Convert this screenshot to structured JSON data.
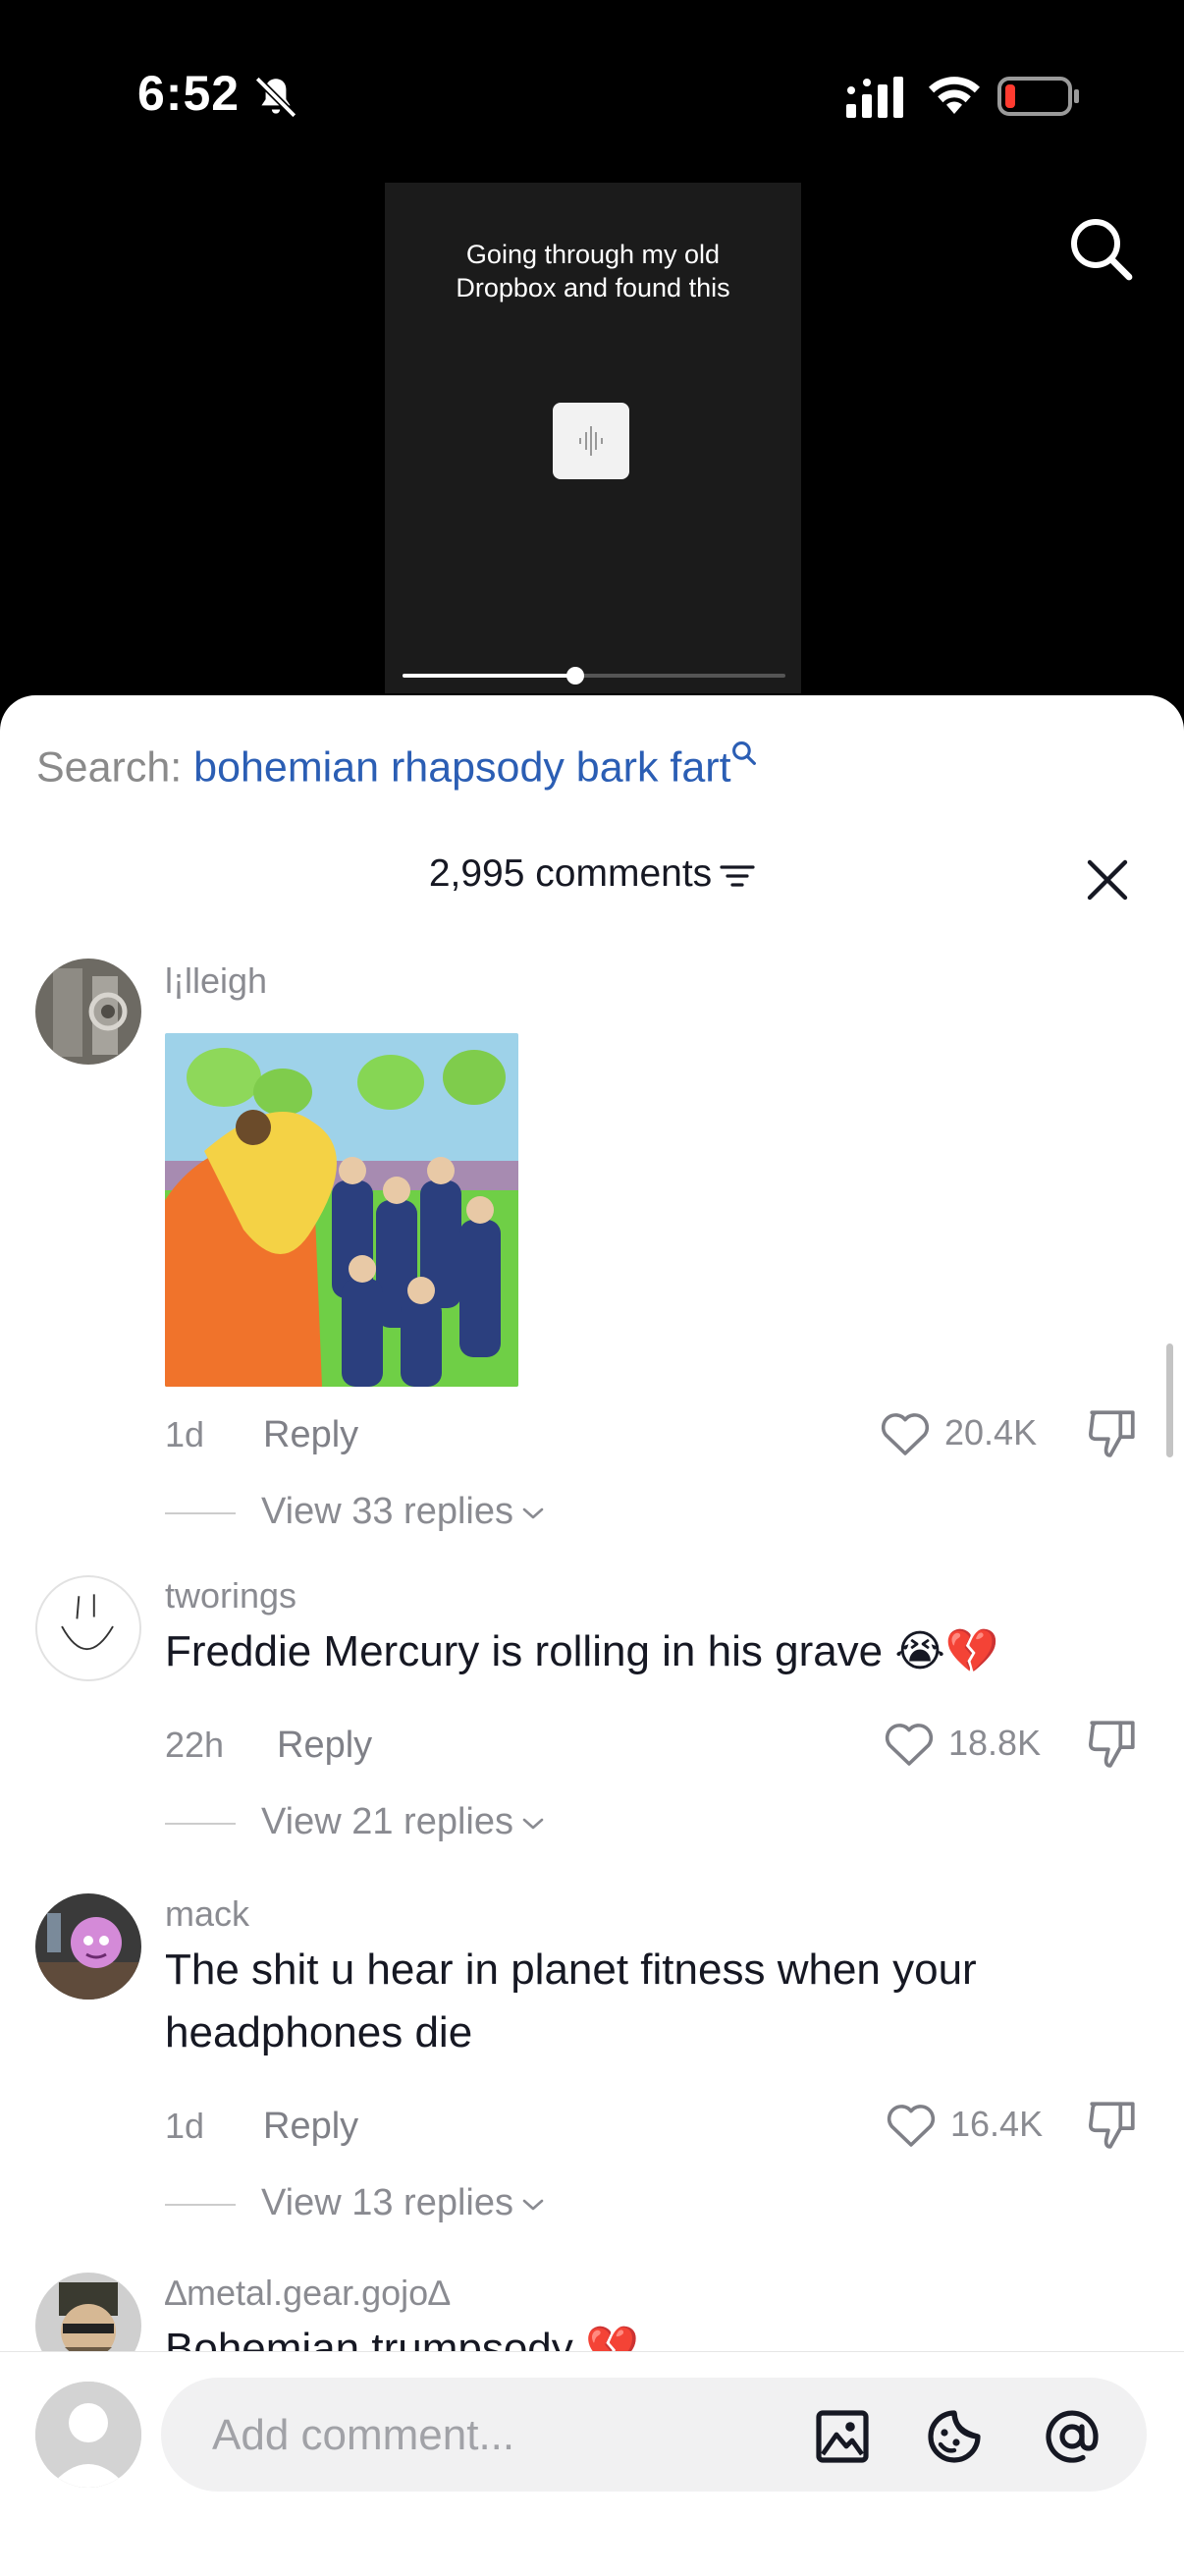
{
  "status": {
    "time": "6:52"
  },
  "video": {
    "caption_line1": "Going through my old",
    "caption_line2": "Dropbox and found this",
    "progress": 0.45
  },
  "sheet": {
    "search_prefix": "Search:",
    "search_query": "bohemian rhapsody bark fart",
    "comment_count": "2,995 comments"
  },
  "comments": [
    {
      "username": "l¡lleigh",
      "text": "",
      "time": "1d",
      "reply_label": "Reply",
      "likes": "20.4K",
      "view_replies": "View 33 replies"
    },
    {
      "username": "tworings",
      "text": "Freddie Mercury is rolling in his grave 😭💔",
      "time": "22h",
      "reply_label": "Reply",
      "likes": "18.8K",
      "view_replies": "View 21 replies"
    },
    {
      "username": "mack",
      "text": "The shit u hear in planet fitness when your headphones die",
      "time": "1d",
      "reply_label": "Reply",
      "likes": "16.4K",
      "view_replies": "View 13 replies"
    },
    {
      "username": "∆metal.gear.gojo∆",
      "text": "Bohemian trumpsody 💔"
    }
  ],
  "composer": {
    "placeholder": "Add comment..."
  },
  "colors": {
    "link": "#2b5eb4",
    "muted": "#8a8b91",
    "text": "#161823"
  }
}
